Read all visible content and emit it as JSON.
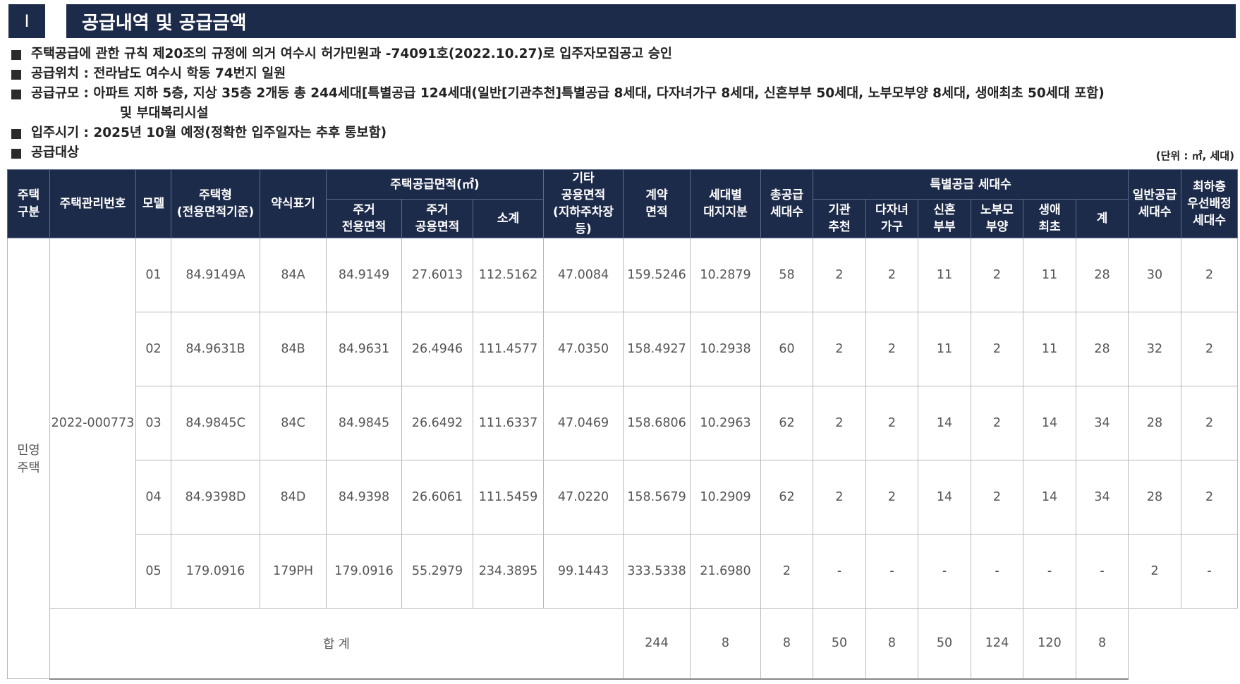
{
  "section": {
    "number": "I",
    "title": "공급내역 및 공급금액"
  },
  "notes": [
    {
      "text": "주택공급에 관한 규칙 제20조의 규정에 의거 여수시 허가민원과 -74091호(2022.10.27)로 입주자모집공고 승인"
    },
    {
      "text": "공급위치 : 전라남도 여수시 학동 74번지 일원"
    },
    {
      "text": "공급규모 : 아파트 지하 5층, 지상 35층 2개동 총 244세대[특별공급 124세대(일반[기관추천]특별공급 8세대, 다자녀가구 8세대, 신혼부부 50세대, 노부모부양 8세대, 생애최초 50세대 포함)",
      "continuation": "및 부대복리시설"
    },
    {
      "text": "입주시기 : 2025년 10월 예정(정확한 입주일자는 추후 통보함)"
    },
    {
      "text": "공급대상"
    }
  ],
  "unit_label": "(단위 : ㎡, 세대)",
  "table": {
    "headers": {
      "housing_type_l1": "주택",
      "housing_type_l2": "구분",
      "mgmt_no": "주택관리번호",
      "model": "모델",
      "type_l1": "주택형",
      "type_l2": "(전용면적기준)",
      "short": "약식표기",
      "area_group": "주택공급면적(㎡)",
      "excl_l1": "주거",
      "excl_l2": "전용면적",
      "common_l1": "주거",
      "common_l2": "공용면적",
      "subtotal": "소계",
      "other_l1": "기타",
      "other_l2": "공용면적",
      "other_l3": "(지하주차장등)",
      "contract_l1": "계약",
      "contract_l2": "면적",
      "land_l1": "세대별",
      "land_l2": "대지지분",
      "total_l1": "총공급",
      "total_l2": "세대수",
      "special_group": "특별공급 세대수",
      "sp_inst_l1": "기관",
      "sp_inst_l2": "추천",
      "sp_multi_l1": "다자녀",
      "sp_multi_l2": "가구",
      "sp_newly_l1": "신혼",
      "sp_newly_l2": "부부",
      "sp_elder_l1": "노부모",
      "sp_elder_l2": "부양",
      "sp_first_l1": "생애",
      "sp_first_l2": "최초",
      "sp_sum": "계",
      "general_l1": "일반공급",
      "general_l2": "세대수",
      "low_l1": "최하층",
      "low_l2": "우선배정",
      "low_l3": "세대수"
    },
    "housing_type": "민영 주택",
    "housing_type_l1": "민영",
    "housing_type_l2": "주택",
    "mgmt_no": "2022-000773",
    "rows": [
      {
        "model": "01",
        "type": "84.9149A",
        "short": "84A",
        "excl": "84.9149",
        "common": "27.6013",
        "subtotal": "112.5162",
        "other": "47.0084",
        "contract": "159.5246",
        "land": "10.2879",
        "total": "58",
        "sp_inst": "2",
        "sp_multi": "2",
        "sp_newly": "11",
        "sp_elder": "2",
        "sp_first": "11",
        "sp_sum": "28",
        "general": "30",
        "low": "2"
      },
      {
        "model": "02",
        "type": "84.9631B",
        "short": "84B",
        "excl": "84.9631",
        "common": "26.4946",
        "subtotal": "111.4577",
        "other": "47.0350",
        "contract": "158.4927",
        "land": "10.2938",
        "total": "60",
        "sp_inst": "2",
        "sp_multi": "2",
        "sp_newly": "11",
        "sp_elder": "2",
        "sp_first": "11",
        "sp_sum": "28",
        "general": "32",
        "low": "2"
      },
      {
        "model": "03",
        "type": "84.9845C",
        "short": "84C",
        "excl": "84.9845",
        "common": "26.6492",
        "subtotal": "111.6337",
        "other": "47.0469",
        "contract": "158.6806",
        "land": "10.2963",
        "total": "62",
        "sp_inst": "2",
        "sp_multi": "2",
        "sp_newly": "14",
        "sp_elder": "2",
        "sp_first": "14",
        "sp_sum": "34",
        "general": "28",
        "low": "2"
      },
      {
        "model": "04",
        "type": "84.9398D",
        "short": "84D",
        "excl": "84.9398",
        "common": "26.6061",
        "subtotal": "111.5459",
        "other": "47.0220",
        "contract": "158.5679",
        "land": "10.2909",
        "total": "62",
        "sp_inst": "2",
        "sp_multi": "2",
        "sp_newly": "14",
        "sp_elder": "2",
        "sp_first": "14",
        "sp_sum": "34",
        "general": "28",
        "low": "2"
      },
      {
        "model": "05",
        "type": "179.0916",
        "short": "179PH",
        "excl": "179.0916",
        "common": "55.2979",
        "subtotal": "234.3895",
        "other": "99.1443",
        "contract": "333.5338",
        "land": "21.6980",
        "total": "2",
        "sp_inst": "-",
        "sp_multi": "-",
        "sp_newly": "-",
        "sp_elder": "-",
        "sp_first": "-",
        "sp_sum": "-",
        "general": "2",
        "low": "-"
      }
    ],
    "total_row": {
      "label": "합 계",
      "total": "244",
      "sp_inst": "8",
      "sp_multi": "8",
      "sp_newly": "50",
      "sp_elder": "8",
      "sp_first": "50",
      "sp_sum": "124",
      "general": "120",
      "low": "8"
    }
  },
  "colors": {
    "header_bg": "#1d2b4a",
    "header_text": "#ffffff",
    "cell_text": "#555555"
  }
}
